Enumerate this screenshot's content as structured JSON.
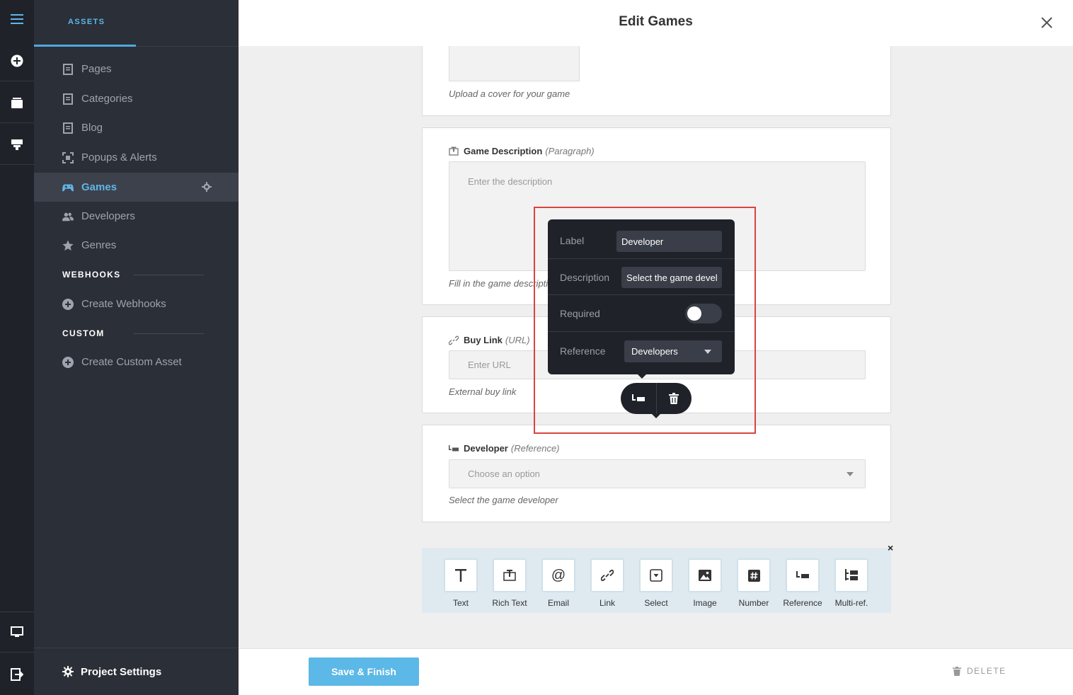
{
  "window": {
    "title": "Edit Games"
  },
  "sidebar": {
    "tab": "ASSETS",
    "items": [
      {
        "label": "Pages",
        "icon": "page-icon"
      },
      {
        "label": "Categories",
        "icon": "page-icon"
      },
      {
        "label": "Blog",
        "icon": "page-icon"
      },
      {
        "label": "Popups & Alerts",
        "icon": "popup-icon"
      },
      {
        "label": "Games",
        "icon": "gamepad-icon",
        "active": true
      },
      {
        "label": "Developers",
        "icon": "users-icon"
      },
      {
        "label": "Genres",
        "icon": "star-icon"
      }
    ],
    "webhooks": {
      "title": "WEBHOOKS",
      "action": "Create Webhooks"
    },
    "custom": {
      "title": "CUSTOM",
      "action": "Create Custom Asset"
    },
    "footer": "Project Settings"
  },
  "form": {
    "cover": {
      "help": "Upload a cover for your game"
    },
    "description": {
      "label": "Game Description",
      "type": "(Paragraph)",
      "placeholder": "Enter the description",
      "help": "Fill in the game description"
    },
    "buy_link": {
      "label": "Buy Link",
      "type": "(URL)",
      "placeholder": "Enter URL",
      "help": "External buy link"
    },
    "developer": {
      "label": "Developer",
      "type": "(Reference)",
      "placeholder": "Choose an option",
      "help": "Select the game developer"
    }
  },
  "popover": {
    "label_caption": "Label",
    "label_value": "Developer",
    "description_caption": "Description",
    "description_value": "Select the game devel",
    "required_caption": "Required",
    "required_on": false,
    "reference_caption": "Reference",
    "reference_value": "Developers"
  },
  "palette": {
    "close": "×",
    "types": [
      {
        "label": "Text",
        "icon": "text-icon"
      },
      {
        "label": "Rich Text",
        "icon": "rich-text-icon"
      },
      {
        "label": "Email",
        "icon": "at-icon"
      },
      {
        "label": "Link",
        "icon": "link-icon"
      },
      {
        "label": "Select",
        "icon": "select-icon"
      },
      {
        "label": "Image",
        "icon": "image-icon"
      },
      {
        "label": "Number",
        "icon": "hash-icon"
      },
      {
        "label": "Reference",
        "icon": "reference-icon"
      },
      {
        "label": "Multi-ref.",
        "icon": "multi-reference-icon"
      }
    ]
  },
  "footer": {
    "save": "Save & Finish",
    "delete": "DELETE"
  },
  "colors": {
    "accent": "#5fb6e8",
    "highlight": "#d9443c",
    "dark": "#1f2229"
  }
}
